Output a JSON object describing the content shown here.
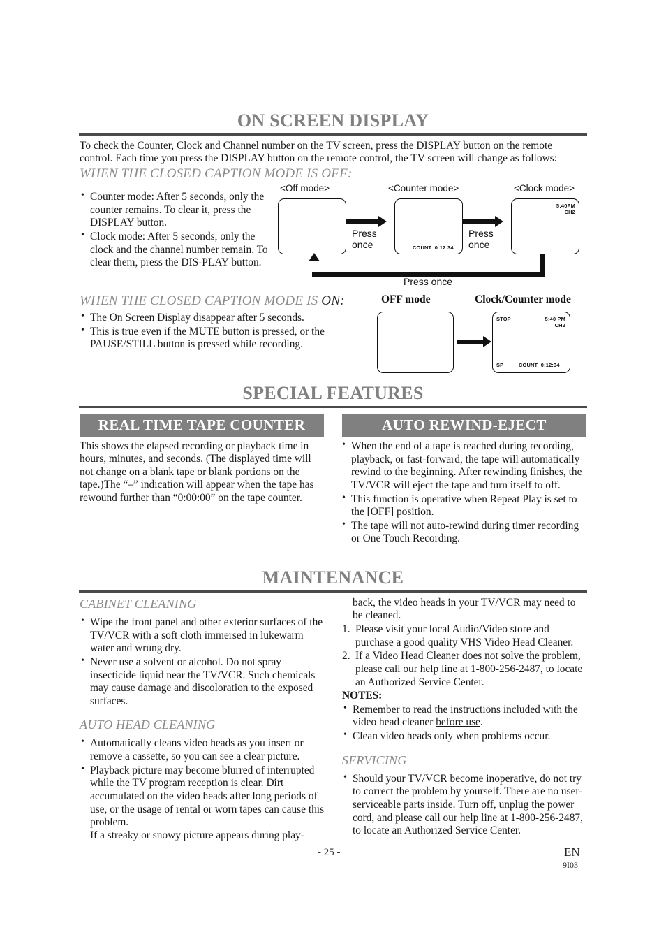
{
  "sections": {
    "on_screen_display": {
      "title": "ON SCREEN DISPLAY",
      "intro": "To check the Counter, Clock and Channel number on the TV screen, press the DISPLAY button on the remote control. Each time you press the DISPLAY button on the remote control, the TV screen will change as follows:",
      "subhead_off": "WHEN THE CLOSED CAPTION MODE IS OFF",
      "subhead_off_colon": ":",
      "bullets_off": [
        "Counter mode: After 5 seconds, only the counter remains. To clear it, press the DISPLAY button.",
        "Clock mode: After 5 seconds, only the clock and the channel number remain. To clear them, press the DIS-PLAY button."
      ],
      "subhead_on_gray": "WHEN THE CLOSED CAPTION MODE IS ",
      "subhead_on_black": "ON:",
      "bullets_on": [
        "The On Screen Display disappear after 5 seconds.",
        "This is true even if the MUTE button is pressed, or the PAUSE/STILL button is pressed while recording."
      ]
    },
    "special_features": {
      "title": "SPECIAL FEATURES",
      "left": {
        "bar_label": "REAL TIME TAPE COUNTER",
        "paragraph": "This shows the elapsed recording or playback time in hours, minutes, and seconds. (The displayed time will not change on a blank tape or blank portions on the tape.)The “–” indication will appear when the tape has rewound further than “0:00:00” on the tape counter."
      },
      "right": {
        "bar_label": "AUTO REWIND-EJECT",
        "bullets": [
          "When the end of a tape is reached during recording, playback, or fast-forward, the tape will automatically rewind to the beginning. After rewinding finishes, the TV/VCR will eject the tape and turn itself to off.",
          "This function is operative when Repeat Play is set to the [OFF] position.",
          "The tape will not auto-rewind during timer recording or One Touch Recording."
        ]
      }
    },
    "maintenance": {
      "title": "MAINTENANCE",
      "left": {
        "heading_cabinet": "CABINET CLEANING",
        "cabinet_bullets": [
          "Wipe the front panel and other exterior surfaces of the TV/VCR with a soft cloth immersed in lukewarm water and wrung dry.",
          "Never use a solvent or alcohol. Do not spray insecticide liquid near the TV/VCR. Such chemicals may cause damage and discoloration to the exposed surfaces."
        ],
        "heading_auto_head": "AUTO HEAD CLEANING",
        "auto_head_bullets": [
          "Automatically cleans video heads as you insert or remove a cassette, so you can see a clear picture.",
          "Playback picture may become blurred of interrupted while the TV program reception is clear. Dirt accumulated on the video heads after long periods of use, or the usage of rental or worn tapes can cause this problem."
        ],
        "auto_head_trailing": "If a streaky or snowy picture appears during play-"
      },
      "right": {
        "continued_text": "back, the video heads in your TV/VCR may need to be cleaned.",
        "numbered": [
          "Please visit your local Audio/Video store and purchase a good quality VHS Video Head Cleaner.",
          "If a Video Head Cleaner does not solve the problem, please call our help line at 1-800-256-2487, to locate an Authorized Service Center."
        ],
        "notes_label": "NOTES:",
        "notes_bullets_part1": "Remember to read the instructions included with the video head cleaner ",
        "notes_bullets_underline": "before use",
        "notes_bullets_part1_end": ".",
        "notes_bullet2": "Clean video heads only when problems occur.",
        "heading_servicing": "SERVICING",
        "servicing_bullets": [
          "Should your TV/VCR become inoperative, do not try to correct the problem by yourself. There are no user-serviceable parts inside. Turn off, unplug the power cord, and please call our help line at 1-800-256-2487, to locate an Authorized Service Center."
        ]
      }
    }
  },
  "diagram_off_caption": {
    "labels": {
      "off_mode": "<Off mode>",
      "counter_mode": "<Counter mode>",
      "clock_mode": "<Clock mode>"
    },
    "transitions": {
      "press_once_line1": "Press",
      "press_once_line2": "once",
      "press_once_bottom": "Press once"
    },
    "counter_screen": {
      "count_label": "COUNT",
      "count_value": "0:12:34"
    },
    "clock_screen": {
      "time": "5:40PM",
      "channel": "CH2"
    }
  },
  "diagram_on_caption": {
    "labels": {
      "off_mode": "OFF mode",
      "clock_counter_mode": "Clock/Counter mode"
    },
    "screen": {
      "status": "STOP",
      "time": "5:40 PM",
      "channel": "CH2",
      "speed": "SP",
      "count_label": "COUNT",
      "count_value": "0:12:34"
    }
  },
  "footer": {
    "page_number": "- 25 -",
    "language": "EN",
    "code": "9I03"
  },
  "colors": {
    "heading_gray": "#808080",
    "rule_dark": "#4a4a4a",
    "bar_gray": "#808080"
  }
}
